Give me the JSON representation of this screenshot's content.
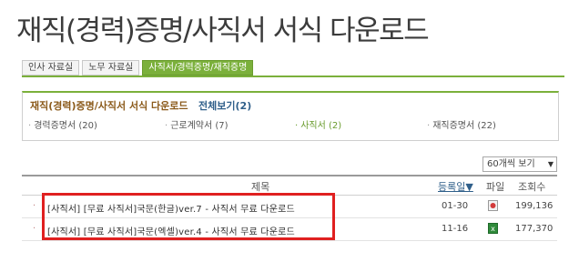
{
  "page": {
    "title": "재직(경력)증명/사직서 서식 다운로드"
  },
  "tabs": [
    {
      "label": "인사 자료실"
    },
    {
      "label": "노무 자료실"
    },
    {
      "label": "사직서/경력증명/재직증명"
    }
  ],
  "category_box": {
    "heading": "재직(경력)증명/사직서 서식 다운로드",
    "view_all": "전체보기(2)",
    "items": [
      {
        "label": "경력증명서 (20)"
      },
      {
        "label": "근로계약서 (7)"
      },
      {
        "label": "사직서 (2)"
      },
      {
        "label": "재직증명서 (22)"
      }
    ]
  },
  "list_size_select": {
    "value": "60개씩 보기"
  },
  "table": {
    "headers": {
      "title": "제목",
      "date": "등록일▼",
      "file": "파일",
      "views": "조회수"
    },
    "rows": [
      {
        "title": "[사직서] [무료 사직서]국문(한글)ver.7 - 사직서 무료 다운로드",
        "date": "01-30",
        "file_icon": "pdf-file-icon",
        "views": "199,136"
      },
      {
        "title": "[사직서] [무료 사직서]국문(엑셀)ver.4 - 사직서 무료 다운로드",
        "date": "11-16",
        "file_icon": "excel-file-icon",
        "views": "177,370"
      }
    ]
  },
  "colors": {
    "accent_green": "#7bb03b",
    "highlight_red": "#e02020"
  }
}
